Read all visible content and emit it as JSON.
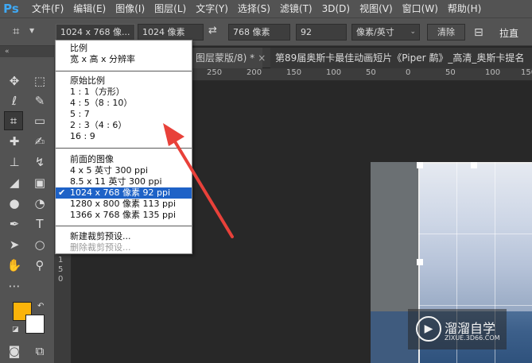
{
  "app": {
    "logo": "Ps"
  },
  "menubar": {
    "items": [
      "文件(F)",
      "编辑(E)",
      "图像(I)",
      "图层(L)",
      "文字(Y)",
      "选择(S)",
      "滤镜(T)",
      "3D(D)",
      "视图(V)",
      "窗口(W)",
      "帮助(H)"
    ]
  },
  "options": {
    "preset": "1024 x 768 像...",
    "width": "1024 像素",
    "height": "768 像素",
    "resolution": "92",
    "unit": "像素/英寸",
    "clear": "清除",
    "straighten": "拉直"
  },
  "tabs": {
    "tab1": "图层蒙版/8) *",
    "tab2": "第89届奥斯卡最佳动画短片《Piper 鹬》_高清_奥斯卡提名"
  },
  "ruler": {
    "top_labels": [
      "250",
      "200",
      "150",
      "100",
      "50",
      "0",
      "50",
      "100",
      "150"
    ],
    "left_label": "150"
  },
  "dropdown": {
    "group1": [
      "比例",
      "宽 x 高 x 分辨率"
    ],
    "group2": [
      "原始比例",
      "1 : 1（方形）",
      "4 : 5（8 : 10）",
      "5 : 7",
      "2 : 3（4 : 6）",
      "16 : 9"
    ],
    "group3": [
      "前面的图像",
      "4 x 5 英寸 300 ppi",
      "8.5 x 11 英寸 300 ppi",
      "1024 x 768 像素 92 ppi",
      "1280 x 800 像素 113 ppi",
      "1366 x 768 像素 135 ppi"
    ],
    "group3_selected": 3,
    "group4": [
      "新建裁剪预设...",
      "删除裁剪预设..."
    ]
  },
  "colors": {
    "foreground": "#fbb40a",
    "background": "#ffffff",
    "annotation_arrow": "#e8413a"
  },
  "watermark": {
    "title": "溜溜自学",
    "url": "ZIXUE.3D66.COM"
  }
}
